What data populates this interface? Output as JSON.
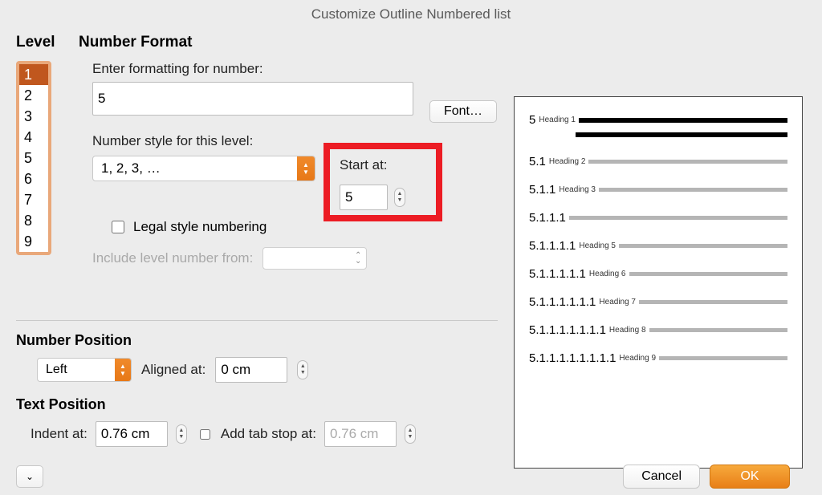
{
  "title": "Customize Outline Numbered list",
  "headers": {
    "level": "Level",
    "format": "Number Format"
  },
  "levels": {
    "items": [
      "1",
      "2",
      "3",
      "4",
      "5",
      "6",
      "7",
      "8",
      "9"
    ],
    "selected_index": 0
  },
  "format": {
    "enter_label": "Enter formatting for number:",
    "value": "5",
    "font_button": "Font…",
    "style_label": "Number style for this level:",
    "style_value": "1, 2, 3, …",
    "start_label": "Start at:",
    "start_value": "5",
    "legal_label": "Legal style numbering",
    "legal_checked": false,
    "include_label": "Include level number from:"
  },
  "number_position": {
    "title": "Number Position",
    "align_value": "Left",
    "aligned_label": "Aligned at:",
    "aligned_value": "0 cm"
  },
  "text_position": {
    "title": "Text Position",
    "indent_label": "Indent at:",
    "indent_value": "0.76 cm",
    "tabstop_label": "Add tab stop at:",
    "tabstop_value": "0.76 cm",
    "tabstop_checked": false
  },
  "preview": {
    "lines": [
      {
        "num": "5",
        "heading": "Heading 1",
        "dark": true,
        "extra_bar": true
      },
      {
        "num": "5.1",
        "heading": "Heading 2"
      },
      {
        "num": "5.1.1",
        "heading": "Heading 3"
      },
      {
        "num": "5.1.1.1",
        "heading": ""
      },
      {
        "num": "5.1.1.1.1",
        "heading": "Heading 5"
      },
      {
        "num": "5.1.1.1.1.1",
        "heading": "Heading 6"
      },
      {
        "num": "5.1.1.1.1.1.1",
        "heading": "Heading 7"
      },
      {
        "num": "5.1.1.1.1.1.1.1",
        "heading": "Heading 8"
      },
      {
        "num": "5.1.1.1.1.1.1.1.1",
        "heading": "Heading 9"
      }
    ]
  },
  "footer": {
    "cancel": "Cancel",
    "ok": "OK"
  }
}
